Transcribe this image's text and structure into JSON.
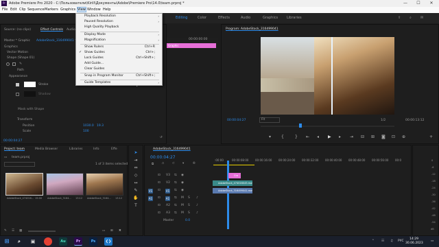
{
  "window": {
    "title": "Adobe Premiere Pro 2020 - C:\\Пользователи\\Kirill\\Документы\\Adobe\\Premiere Pro\\14.0\\team.prproj *",
    "app_icon": "Pr",
    "minimize": "—",
    "maximize": "☐",
    "close": "✕"
  },
  "menu": [
    "File",
    "Edit",
    "Clip",
    "Sequence",
    "Markers",
    "Graphics",
    "View",
    "Window",
    "Help"
  ],
  "workspaces": [
    "Editing",
    "Color",
    "Effects",
    "Audio",
    "Graphics",
    "Libraries"
  ],
  "view_menu": {
    "items": [
      {
        "label": "Playback Resolution",
        "submenu": true
      },
      {
        "label": "Paused Resolution",
        "submenu": true
      },
      {
        "label": "High Quality Playback"
      },
      {
        "label": "Display Mode",
        "submenu": true
      },
      {
        "label": "Magnification",
        "submenu": true
      },
      {
        "label": "Show Rulers",
        "shortcut": "Ctrl+R"
      },
      {
        "label": "Show Guides",
        "shortcut": "Ctrl+;",
        "checked": true
      },
      {
        "label": "Lock Guides",
        "shortcut": "Ctrl+Shift+;"
      },
      {
        "label": "Add Guide..."
      },
      {
        "label": "Clear Guides"
      },
      {
        "label": "Snap in Program Monitor",
        "shortcut": "Ctrl+Shift+;"
      },
      {
        "label": "Guide Templates",
        "submenu": true
      }
    ]
  },
  "effect_controls": {
    "tabs": [
      "Source: (no clips)",
      "Effect Controls",
      "Audio"
    ],
    "master": "Master * Graphic",
    "sequence": "AdobeStock_316499041 * Gr",
    "section": "Graphics",
    "vector_motion": "Vector Motion",
    "shape": "Shape (Shape 01)",
    "path": "Path",
    "appearance": "Appearance",
    "stroke": "Stroke",
    "stroke_value": "20.0",
    "shadow": "Shadow",
    "mask": "Mask with Shape",
    "transform": "Transform",
    "position_label": "Position",
    "position_x": "1030.0",
    "position_y": "19.3",
    "scale_label": "Scale",
    "scale_value": "100",
    "timecode": "00:00:04:27",
    "mini_time": "00:00:00:00",
    "graphic_clip": "Graphic"
  },
  "program": {
    "title": "Program: AdobeStock_316499041",
    "timecode_left": "00:00:04:27",
    "fit": "Fit",
    "ratio": "1/2",
    "timecode_right": "00:00:13:12"
  },
  "project": {
    "tabs": [
      "Project: team",
      "Media Browser",
      "Libraries",
      "Info",
      "Effe"
    ],
    "file": "team.prproj",
    "selected": "1 of 3 items selected",
    "thumbs": [
      {
        "name": "AdobeStock_474016...",
        "dur": "15:00"
      },
      {
        "name": "AdobeStock_3164...",
        "dur": "13:12"
      },
      {
        "name": "AdobeStock_3164...",
        "dur": "13:12"
      }
    ]
  },
  "timeline": {
    "tab": "AdobeStock_316499041",
    "timecode": "00:00:04:27",
    "ruler": [
      ":00:00",
      "00:00:08:00",
      "00:00:16:00",
      "00:00:24:00",
      "00:00:32:00",
      "00:00:40:00",
      "00:00:48:00",
      "00:00:56:00",
      "00:0"
    ],
    "tracks": [
      "V3",
      "V2",
      "V1",
      "A1",
      "A2",
      "A3"
    ],
    "master": "Master",
    "master_value": "0.0",
    "clips": {
      "graphic": "Gra",
      "v2": "AdobeStock_474016045.mov",
      "v1": "AdobeStock_316499041.mov"
    },
    "meter_labels": [
      "0",
      "-6",
      "-12",
      "-18",
      "-24",
      "-30",
      "-36",
      "-42",
      "-48",
      "-54",
      "dB"
    ]
  },
  "taskbar": {
    "time": "14:29",
    "date": "30.06.2023",
    "lang": "РУС",
    "apps": [
      "Au",
      "Pr",
      "Ps"
    ]
  }
}
